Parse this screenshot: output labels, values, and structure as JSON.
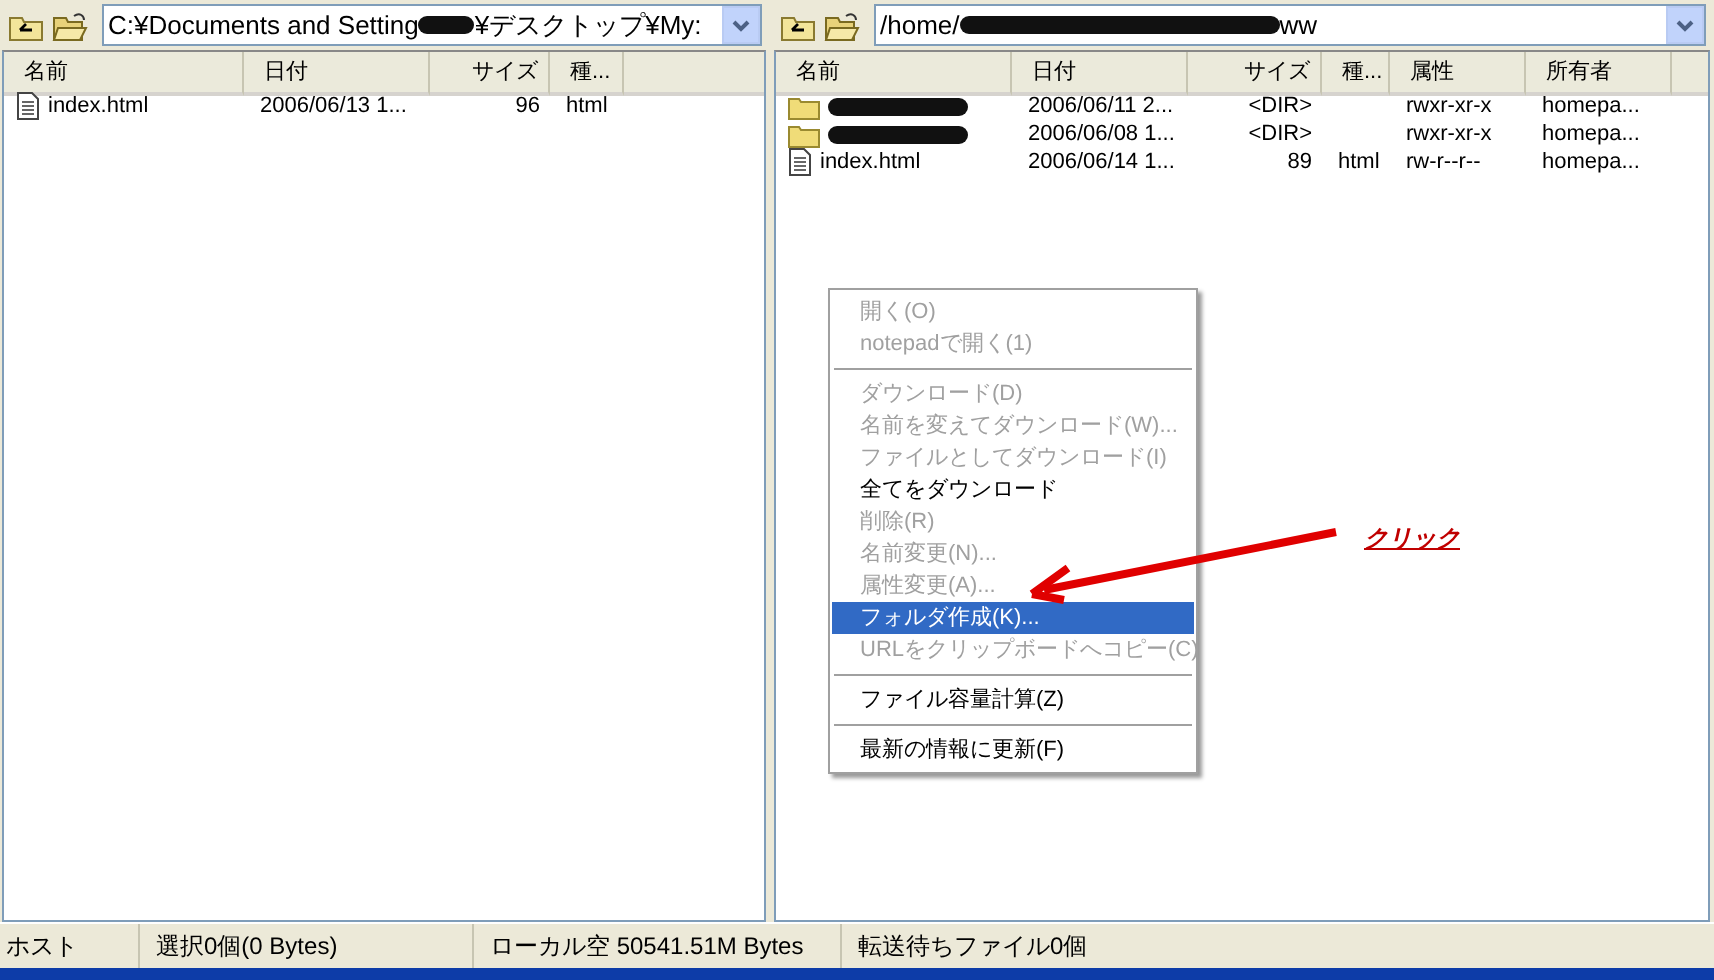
{
  "panes": [
    {
      "path_parts": [
        "C:¥Documents and Setting",
        "¥デスクトップ¥My:"
      ],
      "columns": [
        "名前",
        "日付",
        "サイズ",
        "種..."
      ],
      "rows": [
        {
          "kind": "file",
          "cells": [
            "index.html",
            "2006/06/13 1...",
            "96",
            "html"
          ]
        }
      ]
    },
    {
      "path_parts": [
        "/home/",
        "ww"
      ],
      "columns": [
        "名前",
        "日付",
        "サイズ",
        "種...",
        "属性",
        "所有者"
      ],
      "rows": [
        {
          "kind": "folder",
          "cells": [
            "",
            "2006/06/11 2...",
            "<DIR>",
            "",
            "rwxr-xr-x",
            "homepa..."
          ]
        },
        {
          "kind": "folder",
          "cells": [
            "",
            "2006/06/08 1...",
            "<DIR>",
            "",
            "rwxr-xr-x",
            "homepa..."
          ]
        },
        {
          "kind": "file",
          "cells": [
            "index.html",
            "2006/06/14 1...",
            "89",
            "html",
            "rw-r--r--",
            "homepa..."
          ]
        }
      ]
    }
  ],
  "context_menu": [
    {
      "label": "開く(O)",
      "disabled": true,
      "selected": false,
      "separator_after": false
    },
    {
      "label": "notepadで開く(1)",
      "disabled": true,
      "selected": false,
      "separator_after": true
    },
    {
      "label": "ダウンロード(D)",
      "disabled": true,
      "selected": false,
      "separator_after": false
    },
    {
      "label": "名前を変えてダウンロード(W)...",
      "disabled": true,
      "selected": false,
      "separator_after": false
    },
    {
      "label": "ファイルとしてダウンロード(I)",
      "disabled": true,
      "selected": false,
      "separator_after": false
    },
    {
      "label": "全てをダウンロード",
      "disabled": false,
      "selected": false,
      "separator_after": false
    },
    {
      "label": "削除(R)",
      "disabled": true,
      "selected": false,
      "separator_after": false
    },
    {
      "label": "名前変更(N)...",
      "disabled": true,
      "selected": false,
      "separator_after": false
    },
    {
      "label": "属性変更(A)...",
      "disabled": true,
      "selected": false,
      "separator_after": false
    },
    {
      "label": "フォルダ作成(K)...",
      "disabled": false,
      "selected": true,
      "separator_after": false
    },
    {
      "label": "URLをクリップボードへコピー(C)",
      "disabled": true,
      "selected": false,
      "separator_after": true
    },
    {
      "label": "ファイル容量計算(Z)",
      "disabled": false,
      "selected": false,
      "separator_after": true
    },
    {
      "label": "最新の情報に更新(F)",
      "disabled": false,
      "selected": false,
      "separator_after": false
    }
  ],
  "annotation": {
    "label": "クリック"
  },
  "status_bar": [
    "ホスト",
    "選択0個(0 Bytes)",
    "ローカル空 50541.51M Bytes",
    "転送待ちファイル0個"
  ]
}
